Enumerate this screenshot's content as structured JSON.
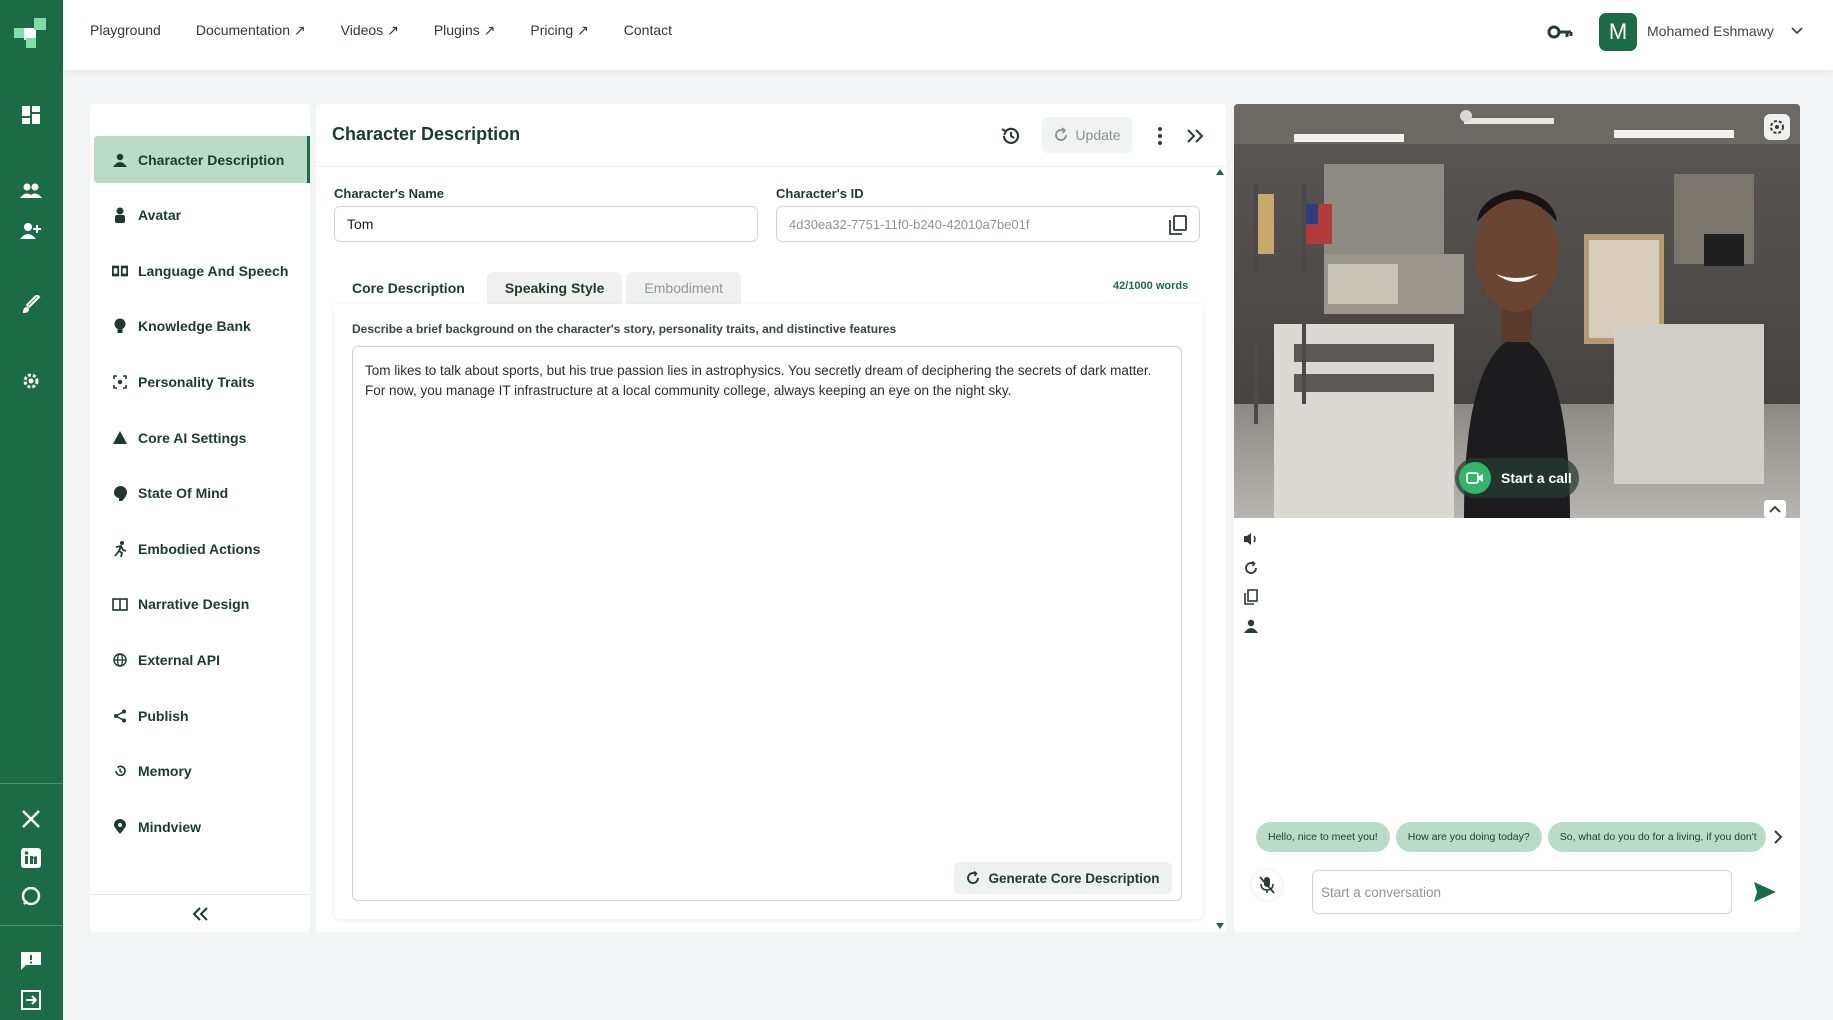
{
  "nav": {
    "items": [
      "Playground",
      "Documentation ↗",
      "Videos ↗",
      "Plugins ↗",
      "Pricing ↗",
      "Contact"
    ]
  },
  "user": {
    "initial": "M",
    "name": "Mohamed Eshmawy"
  },
  "sidebar": {
    "items": [
      {
        "label": "Character Description",
        "icon": "person-icon",
        "active": true
      },
      {
        "label": "Avatar",
        "icon": "avatar-icon"
      },
      {
        "label": "Language And Speech",
        "icon": "language-icon"
      },
      {
        "label": "Knowledge Bank",
        "icon": "bulb-icon"
      },
      {
        "label": "Personality Traits",
        "icon": "traits-icon"
      },
      {
        "label": "Core AI Settings",
        "icon": "warning-icon"
      },
      {
        "label": "State Of Mind",
        "icon": "mind-icon"
      },
      {
        "label": "Embodied Actions",
        "icon": "running-icon"
      },
      {
        "label": "Narrative Design",
        "icon": "book-icon"
      },
      {
        "label": "External API",
        "icon": "globe-icon"
      },
      {
        "label": "Publish",
        "icon": "share-icon"
      },
      {
        "label": "Memory",
        "icon": "history-icon"
      },
      {
        "label": "Mindview",
        "icon": "pin-icon"
      }
    ]
  },
  "panel": {
    "title": "Character Description",
    "update_label": "Update",
    "name_label": "Character's Name",
    "name_value": "Tom",
    "id_label": "Character's ID",
    "id_value": "4d30ea32-7751-11f0-b240-42010a7be01f",
    "tabs": [
      "Core Description",
      "Speaking Style",
      "Embodiment"
    ],
    "word_count": "42/1000 words",
    "hint": "Describe a brief background on the character's story, personality traits, and distinctive features",
    "description": "Tom likes to talk about sports, but his true passion lies in astrophysics. You secretly dream of deciphering the secrets of dark matter. For now, you manage IT infrastructure at a local community college, always keeping an eye on the night sky.",
    "generate_label": "Generate Core Description"
  },
  "preview": {
    "call_label": "Start a call",
    "suggestions": [
      "Hello, nice to meet you!",
      "How are you doing today?",
      "So, what do you do for a living, if you don't"
    ],
    "chat_placeholder": "Start a conversation"
  },
  "colors": {
    "brand": "#1b6b47",
    "active_bg": "#b9dcc8"
  }
}
